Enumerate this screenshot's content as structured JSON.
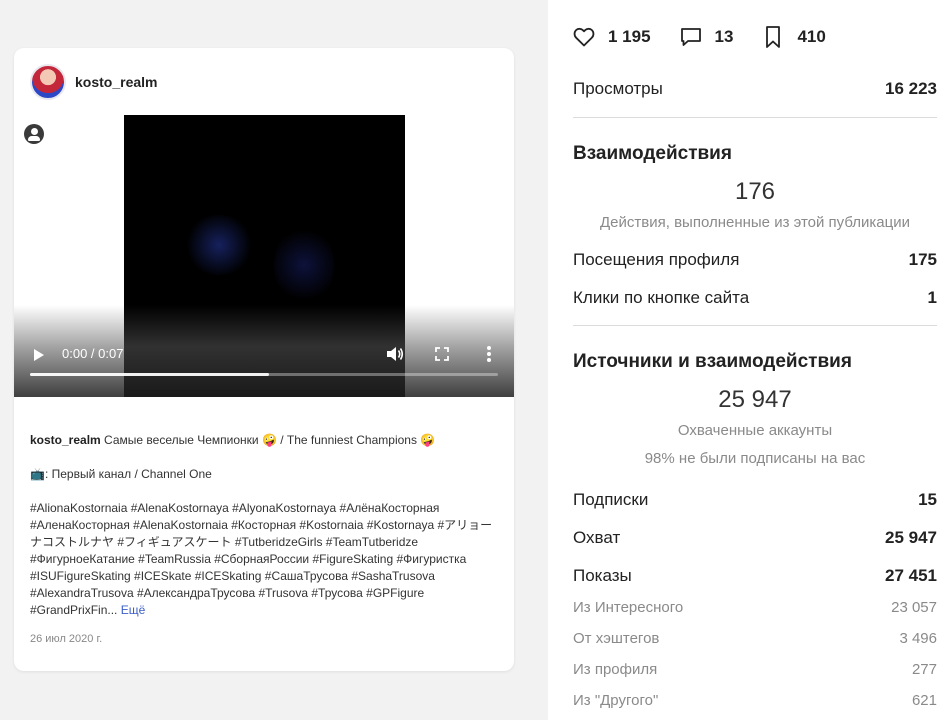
{
  "post": {
    "username": "kosto_realm",
    "video": {
      "time_label": "0:00 / 0:07",
      "progress": 0.51
    },
    "caption": {
      "author": "kosto_realm",
      "text": "Самые веселые Чемпионки 🤪 / The funniest Champions 🤪",
      "line2": "📺: Первый канал / Channel One",
      "hashtags": "#AlionaKostornaia #AlenaKostornaya #AlyonaKostornaya #АлёнаКосторная #АленаКосторная #AlenaKostornaia #Косторная #Kostornaia #Kostornaya #アリョーナコストルナヤ #フィギュアスケート #TutberidzeGirls #TeamTutberidze #ФигурноеКатание #TeamRussia #СборнаяРоссии #FigureSkating #Фигуристка #ISUFigureSkating #ICESkate #ICESkating #СашаТрусова #SashaTrusova #AlexandraTrusova #АлександраТрусова #Trusova #Трусова #GPFigure #GrandPrixFin...",
      "more_label": "Ещё"
    },
    "date": "26 июл 2020 г."
  },
  "stats": {
    "likes": "1 195",
    "comments": "13",
    "saves": "410"
  },
  "insights": {
    "views": {
      "label": "Просмотры",
      "value": "16 223"
    },
    "interactions": {
      "title": "Взаимодействия",
      "total": "176",
      "total_note": "Действия, выполненные из этой публикации",
      "rows": [
        {
          "label": "Посещения профиля",
          "value": "175"
        },
        {
          "label": "Клики по кнопке сайта",
          "value": "1"
        }
      ]
    },
    "discovery": {
      "title": "Источники и взаимодействия",
      "total": "25 947",
      "total_note": "Охваченные аккаунты",
      "sub_note": "98% не были подписаны на вас",
      "rows": [
        {
          "label": "Подписки",
          "value": "15"
        },
        {
          "label": "Охват",
          "value": "25 947"
        },
        {
          "label": "Показы",
          "value": "27 451"
        }
      ],
      "sources": [
        {
          "label": "Из Интересного",
          "value": "23 057"
        },
        {
          "label": "От хэштегов",
          "value": "3 496"
        },
        {
          "label": "Из профиля",
          "value": "277"
        },
        {
          "label": "Из \"Другого\"",
          "value": "621"
        }
      ]
    }
  }
}
